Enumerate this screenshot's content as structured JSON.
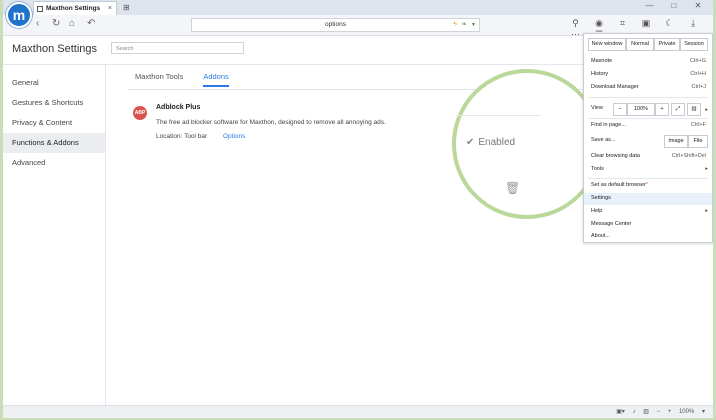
{
  "browser": {
    "tab_title": "Maxthon Settings",
    "tab_close": "×",
    "address": "options",
    "window_buttons": [
      "—",
      "□",
      "✕"
    ]
  },
  "toolbar_icons": [
    "user-icon",
    "abp-icon",
    "crop-icon",
    "snapshot-icon",
    "night-icon",
    "download-icon",
    "more-icon",
    "menu-icon"
  ],
  "toolbar_glyphs": [
    "⚲",
    "◉",
    "⌗",
    "▣",
    "☾",
    "⤓",
    "⋯",
    "☰"
  ],
  "settings": {
    "title": "Maxthon Settings",
    "search_placeholder": "Search",
    "sidebar": [
      {
        "label": "General"
      },
      {
        "label": "Gestures & Shortcuts"
      },
      {
        "label": "Privacy & Content"
      },
      {
        "label": "Functions & Addons",
        "active": true
      },
      {
        "label": "Advanced"
      }
    ],
    "tabs": [
      {
        "label": "Maxthon Tools"
      },
      {
        "label": "Addons",
        "selected": true
      }
    ],
    "addon": {
      "icon_text": "ABP",
      "name": "Adblock Plus",
      "description": "The free ad blocker software for Maxthon, designed to remove all annoying ads.",
      "location": "Location: Tool bar",
      "options": "Options",
      "enabled_label": "Enabled",
      "enabled": true
    }
  },
  "menu": {
    "window_buttons": [
      "New window",
      "Normal",
      "Private",
      "Session"
    ],
    "maxnote": {
      "label": "Maxnote",
      "shortcut": "Ctrl+G"
    },
    "history": {
      "label": "History",
      "shortcut": "Ctrl+H"
    },
    "download_manager": {
      "label": "Download Manager",
      "shortcut": "Ctrl+J"
    },
    "view": {
      "label": "View",
      "zoom_out": "−",
      "zoom": "100%",
      "zoom_in": "+"
    },
    "find": {
      "label": "Find in page...",
      "shortcut": "Ctrl+F"
    },
    "save_as": {
      "label": "Save as...",
      "image": "Image",
      "file": "File"
    },
    "clear": {
      "label": "Clear browsing data",
      "shortcut": "Ctrl+Shift+Del"
    },
    "tools": {
      "label": "Tools"
    },
    "default_browser": {
      "label": "Set as default browser",
      "marker": "*"
    },
    "settings": {
      "label": "Settings"
    },
    "help": {
      "label": "Help"
    },
    "message_center": {
      "label": "Message Center"
    },
    "about": {
      "label": "About..."
    }
  },
  "status": {
    "zoom": "100%"
  },
  "colors": {
    "accent": "#2c7be5",
    "magnifier_ring": "#b9d89a",
    "abp_red": "#d9534f"
  }
}
